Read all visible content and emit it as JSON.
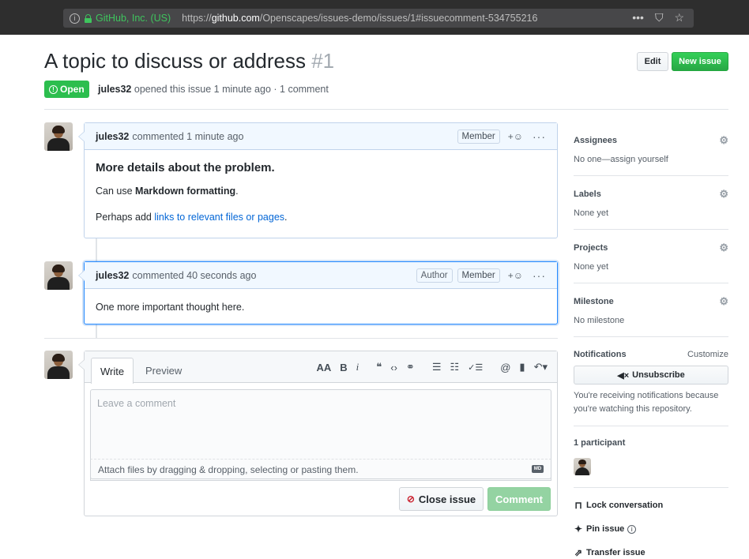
{
  "browser": {
    "org": "GitHub, Inc. (US)",
    "url_prefix": "https://",
    "url_host": "github.com",
    "url_path": "/Openscapes/issues-demo/issues/1#issuecomment-534755216",
    "tools": [
      "•••",
      "⛉",
      "☆"
    ]
  },
  "issue": {
    "title": "A topic to discuss or address",
    "number": "#1",
    "state": "Open",
    "author": "jules32",
    "meta": "opened this issue 1 minute ago · 1 comment",
    "edit_label": "Edit",
    "new_issue_label": "New issue"
  },
  "comments": [
    {
      "author": "jules32",
      "time": "commented 1 minute ago",
      "badges": [
        "Member"
      ],
      "heading": "More details about the problem.",
      "line1_pre": "Can use ",
      "line1_bold": "Markdown formatting",
      "line1_post": ".",
      "line2_pre": "Perhaps add ",
      "line2_link": "links to relevant files or pages",
      "line2_post": "."
    },
    {
      "author": "jules32",
      "time": "commented 40 seconds ago",
      "badges": [
        "Author",
        "Member"
      ],
      "text": "One more important thought here."
    }
  ],
  "composer": {
    "tab_write": "Write",
    "tab_preview": "Preview",
    "placeholder": "Leave a comment",
    "attach_text": "Attach files by dragging & dropping, selecting or pasting them.",
    "close_label": "Close issue",
    "comment_label": "Comment",
    "tool_heading": "AA",
    "tool_bold": "B",
    "tool_italic": "i",
    "tool_quote": "❝",
    "tool_code": "‹›",
    "tool_link": "⚭",
    "tool_ul": "☰",
    "tool_ol": "☷",
    "tool_task": "✓☰",
    "tool_mention": "@",
    "tool_ref": "▮",
    "tool_reply": "↶▾",
    "md_badge": "MD"
  },
  "sidebar": {
    "assignees": {
      "title": "Assignees",
      "value": "No one—assign yourself"
    },
    "labels": {
      "title": "Labels",
      "value": "None yet"
    },
    "projects": {
      "title": "Projects",
      "value": "None yet"
    },
    "milestone": {
      "title": "Milestone",
      "value": "No milestone"
    },
    "notifications": {
      "title": "Notifications",
      "customize": "Customize",
      "unsubscribe": "Unsubscribe",
      "note": "You're receiving notifications because you're watching this repository."
    },
    "participants": {
      "title": "1 participant"
    },
    "lock": "Lock conversation",
    "pin": "Pin issue",
    "transfer": "Transfer issue"
  }
}
